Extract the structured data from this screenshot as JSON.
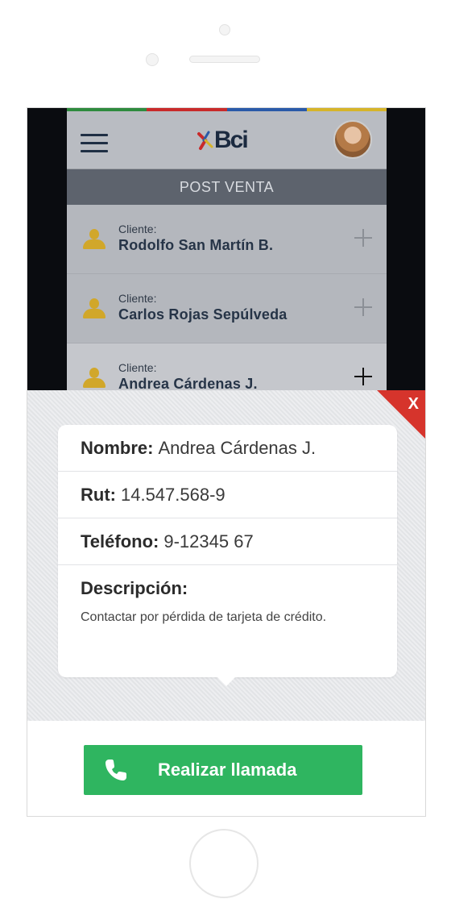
{
  "app": {
    "brand": "Bci",
    "colors": {
      "strip": [
        "#2e8b3e",
        "#c82a2a",
        "#2a5aa8",
        "#d6b42a"
      ],
      "accent": "#2fb560",
      "close": "#d6342c",
      "client_icon": "#d1a72a"
    },
    "section_title": "POST VENTA",
    "clients": [
      {
        "label": "Cliente:",
        "name": "Rodolfo San Martín B."
      },
      {
        "label": "Cliente:",
        "name": "Carlos Rojas Sepúlveda"
      },
      {
        "label": "Cliente:",
        "name": "Andrea Cárdenas J."
      }
    ]
  },
  "detail": {
    "close_label": "X",
    "name_key": "Nombre:",
    "name_value": "Andrea Cárdenas J.",
    "rut_key": "Rut:",
    "rut_value": "14.547.568-9",
    "phone_key": "Teléfono:",
    "phone_value": "9-12345 67",
    "description_key": "Descripción:",
    "description_value": "Contactar por pérdida de tarjeta de crédito.",
    "call_button": "Realizar llamada"
  },
  "icons": [
    "menu-icon",
    "brand-logo",
    "avatar",
    "client-icon",
    "plus-icon",
    "close-icon",
    "phone-icon"
  ]
}
